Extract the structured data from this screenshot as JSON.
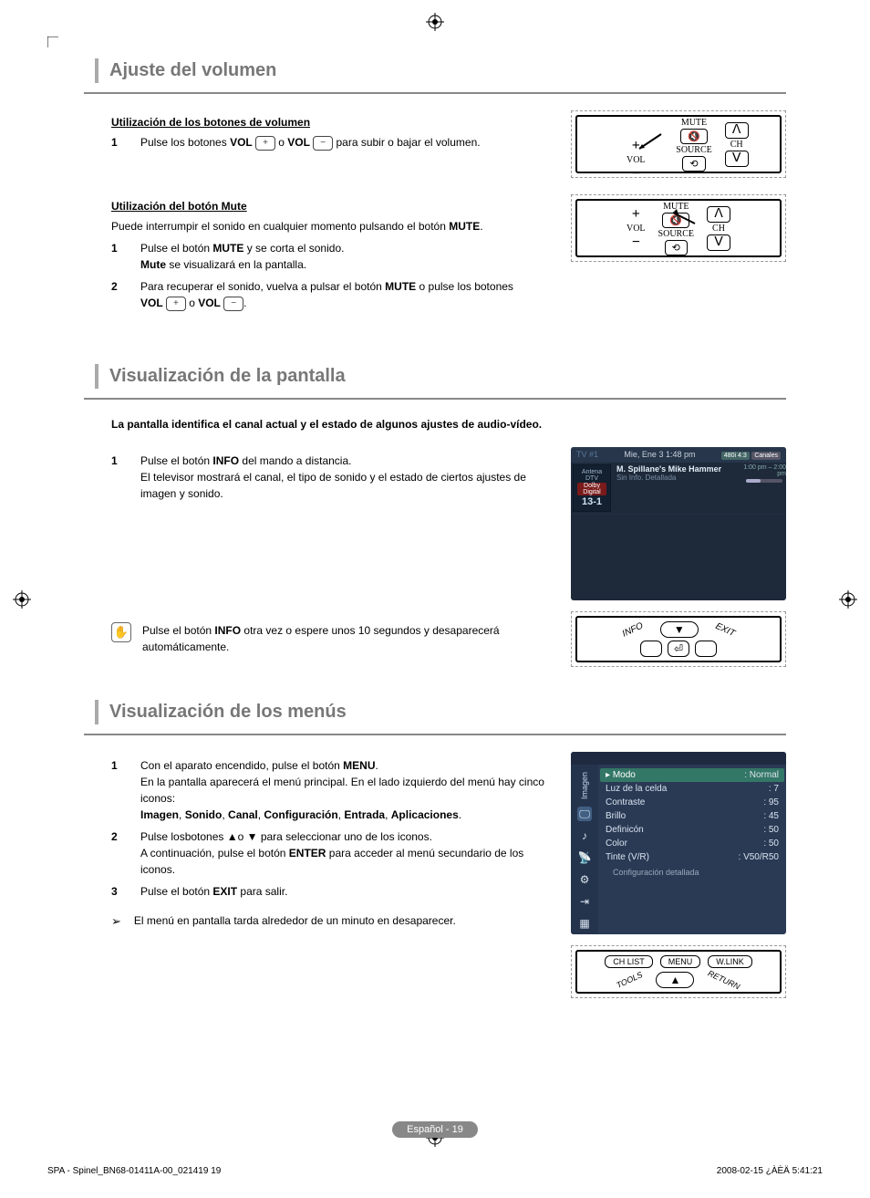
{
  "section1": {
    "title": "Ajuste del volumen",
    "sub1": "Utilización de los botones de volumen",
    "step1_num": "1",
    "step1_a": "Pulse los botones ",
    "step1_b": "VOL",
    "step1_plus": "+",
    "step1_c": " o ",
    "step1_d": "VOL",
    "step1_minus": "−",
    "step1_e": " para subir o bajar el volumen.",
    "sub2": "Utilización del botón Mute",
    "intro2": "Puede interrumpir el sonido en cualquier momento pulsando el botón ",
    "intro2_bold": "MUTE",
    "intro2_end": ".",
    "m1_num": "1",
    "m1_a": "Pulse el botón ",
    "m1_b": "MUTE",
    "m1_c": " y se corta el sonido.",
    "m1_d": "Mute",
    "m1_e": " se visualizará en la pantalla.",
    "m2_num": "2",
    "m2_a": "Para recuperar el sonido, vuelva a pulsar el botón ",
    "m2_b": "MUTE",
    "m2_c": " o pulse los botones",
    "m2_d": "VOL",
    "m2_plus": "+",
    "m2_e": " o ",
    "m2_f": "VOL",
    "m2_minus": "−",
    "m2_g": "."
  },
  "remote1": {
    "vol": "VOL",
    "mute": "MUTE",
    "source": "SOURCE",
    "ch": "CH",
    "plus": "+",
    "minus": "−",
    "up": "ᐱ",
    "down": "ᐯ"
  },
  "section2": {
    "title": "Visualización de la pantalla",
    "lead": "La pantalla identifica el canal actual y el estado de algunos ajustes de audio-vídeo.",
    "s1_num": "1",
    "s1_a": "Pulse el botón ",
    "s1_b": "INFO",
    "s1_c": " del mando a distancia.",
    "s1_d": "El televisor mostrará el canal, el tipo de sonido y el estado de ciertos ajustes de imagen y sonido.",
    "note_a": "Pulse el botón ",
    "note_b": "INFO",
    "note_c": " otra vez o espere unos 10 segundos y desaparecerá automáticamente."
  },
  "tv": {
    "topleft": "TV #1",
    "topdate": "Mie, Ene 3  1:48 pm",
    "badge1": "480i 4:3",
    "badge2": "Canales",
    "src": "Antena DTV",
    "flag": "Dolby Digital",
    "prog": "M. Spillane's Mike Hammer",
    "time": "1:00 pm – 2:00 pm",
    "meta": "Sin Info. Detallada",
    "chnum": "13-1"
  },
  "section3": {
    "title": "Visualización de los menús",
    "s1_num": "1",
    "s1_a": "Con el aparato encendido, pulse el botón ",
    "s1_b": "MENU",
    "s1_c": ".",
    "s1_d": "En la pantalla aparecerá el menú principal. En el lado izquierdo del menú hay cinco iconos:",
    "s1_e1": "Imagen",
    "s1_e2": "Sonido",
    "s1_e3": "Canal",
    "s1_e4": "Configuración",
    "s1_e5": "Entrada",
    "s1_e6": "Aplicaciones",
    "s2_num": "2",
    "s2_a": "Pulse losbotones ▲o ▼ para seleccionar uno de los iconos.",
    "s2_b": "A continuación, pulse el botón ",
    "s2_c": "ENTER",
    "s2_d": " para acceder al menú secundario de los iconos.",
    "s3_num": "3",
    "s3_a": "Pulse el botón ",
    "s3_b": "EXIT",
    "s3_c": " para salir.",
    "bullet": "El menú en pantalla tarda alrededor de un minuto en desaparecer."
  },
  "menu": {
    "side": "Imagen",
    "r0k": "Modo",
    "r0v": ": Normal",
    "r1k": "Luz de la celda",
    "r1v": ": 7",
    "r2k": "Contraste",
    "r2v": ": 95",
    "r3k": "Brillo",
    "r3v": ": 45",
    "r4k": "Definicón",
    "r4v": ": 50",
    "r5k": "Color",
    "r5v": ": 50",
    "r6k": "Tinte (V/R)",
    "r6v": ": V50/R50",
    "foot": "Configuración detallada"
  },
  "remote2": {
    "chlist": "CH LIST",
    "menu": "MENU",
    "wlink": "W.LINK",
    "tools": "TOOLS",
    "return": "RETURN",
    "up": "▲",
    "down": "▼",
    "info": "INFO",
    "exit": "EXIT"
  },
  "footer_pill": "Español - 19",
  "doc_left": "SPA - Spinel_BN68-01411A-00_021419   19",
  "doc_right": "2008-02-15   ¿ÀÈÄ 5:41:21"
}
